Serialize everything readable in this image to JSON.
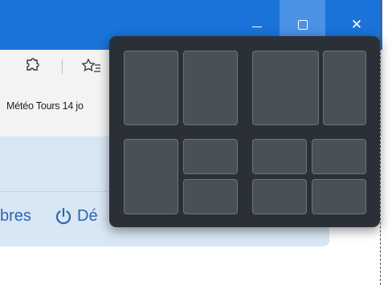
{
  "window_controls": {
    "minimize": "minimize-icon",
    "maximize": "maximize-icon",
    "close": "close-icon",
    "close_glyph": "✕"
  },
  "toolbar": {
    "extensions_icon": "puzzle-icon",
    "favorites_icon": "favorites-icon",
    "favorites_bar_item": "Météo Tours 14 jo"
  },
  "page": {
    "nav_text_1": "bres",
    "nav_text_2": "Dé"
  },
  "snap_layouts": {
    "layouts": [
      "two-columns",
      "two-columns-wide-left",
      "three-split",
      "four-grid"
    ]
  },
  "colors": {
    "titlebar": "#1a73d9",
    "flyout": "#2b3038",
    "banner": "#d9e6f3",
    "link": "#2b66b0"
  }
}
